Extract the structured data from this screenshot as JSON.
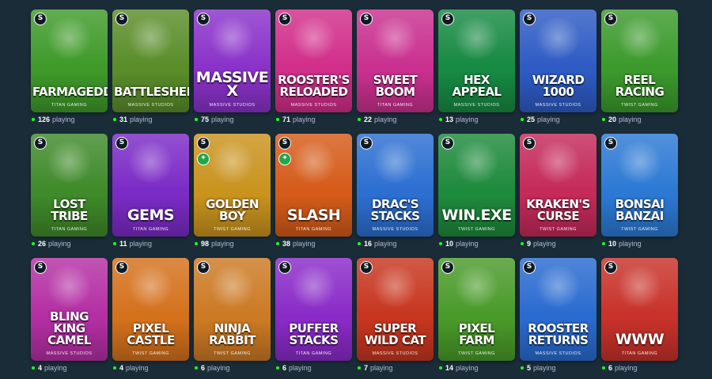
{
  "playing_label": "playing",
  "games": [
    {
      "title": "FARMAGEDDON",
      "studio": "TITAN GAMING",
      "players": "126",
      "color": "#3f9a2a",
      "boost": false
    },
    {
      "title": "BATTLESHEEPS",
      "studio": "MASSIVE STUDIOS",
      "players": "31",
      "color": "#5a8d2a",
      "boost": false
    },
    {
      "title": "MASSIVE X",
      "studio": "MASSIVE STUDIOS",
      "players": "75",
      "color": "#8a32c9",
      "boost": false
    },
    {
      "title": "ROOSTER'S\nRELOADED",
      "studio": "MASSIVE STUDIOS",
      "players": "71",
      "color": "#d12e8a",
      "boost": false
    },
    {
      "title": "SWEET\nBOOM",
      "studio": "TITAN GAMING",
      "players": "22",
      "color": "#c9308f",
      "boost": false
    },
    {
      "title": "HEX\nAPPEAL",
      "studio": "MASSIVE STUDIOS",
      "players": "13",
      "color": "#178a43",
      "boost": false
    },
    {
      "title": "WIZARD\n1000",
      "studio": "MASSIVE STUDIOS",
      "players": "25",
      "color": "#2e5bc4",
      "boost": false
    },
    {
      "title": "REEL\nRACING",
      "studio": "TWIST GAMING",
      "players": "20",
      "color": "#3c9a2c",
      "boost": false
    },
    {
      "title": "LOST\nTRIBE",
      "studio": "TITAN GAMING",
      "players": "26",
      "color": "#3f8a2a",
      "boost": false
    },
    {
      "title": "GEMS",
      "studio": "TITAN GAMING",
      "players": "11",
      "color": "#7b2bc6",
      "boost": false
    },
    {
      "title": "GOLDEN\nBOY",
      "studio": "TWIST GAMING",
      "players": "98",
      "color": "#c9931e",
      "boost": true
    },
    {
      "title": "SLASH",
      "studio": "TITAN GAMING",
      "players": "38",
      "color": "#d55b1a",
      "boost": true
    },
    {
      "title": "DRAC'S\nSTACKS",
      "studio": "MASSIVE STUDIOS",
      "players": "16",
      "color": "#2c6fd1",
      "boost": false
    },
    {
      "title": "WIN.EXE",
      "studio": "TWIST GAMING",
      "players": "10",
      "color": "#1e8a3c",
      "boost": false
    },
    {
      "title": "KRAKEN'S\nCURSE",
      "studio": "TWIST GAMING",
      "players": "9",
      "color": "#c42a5a",
      "boost": false
    },
    {
      "title": "BONSAI\nBANZAI",
      "studio": "TWIST GAMING",
      "players": "10",
      "color": "#2c79d4",
      "boost": false
    },
    {
      "title": "BLING\nKING CAMEL",
      "studio": "MASSIVE STUDIOS",
      "players": "4",
      "color": "#b42fa4",
      "boost": false
    },
    {
      "title": "PIXEL\nCASTLE",
      "studio": "TWIST GAMING",
      "players": "4",
      "color": "#d4711c",
      "boost": false
    },
    {
      "title": "NINJA\nRABBIT",
      "studio": "TWIST GAMING",
      "players": "6",
      "color": "#cc7a24",
      "boost": false
    },
    {
      "title": "PUFFER\nSTACKS",
      "studio": "TITAN GAMING",
      "players": "6",
      "color": "#8a2bc8",
      "boost": false
    },
    {
      "title": "SUPER\nWILD CAT",
      "studio": "MASSIVE STUDIOS",
      "players": "7",
      "color": "#c7361f",
      "boost": false
    },
    {
      "title": "PIXEL\nFARM",
      "studio": "TWIST GAMING",
      "players": "14",
      "color": "#4a9a2a",
      "boost": false
    },
    {
      "title": "ROOSTER\nRETURNS",
      "studio": "MASSIVE STUDIOS",
      "players": "5",
      "color": "#2a6bd0",
      "boost": false
    },
    {
      "title": "WWW",
      "studio": "TITAN GAMING",
      "players": "6",
      "color": "#c8322a",
      "boost": false
    }
  ]
}
